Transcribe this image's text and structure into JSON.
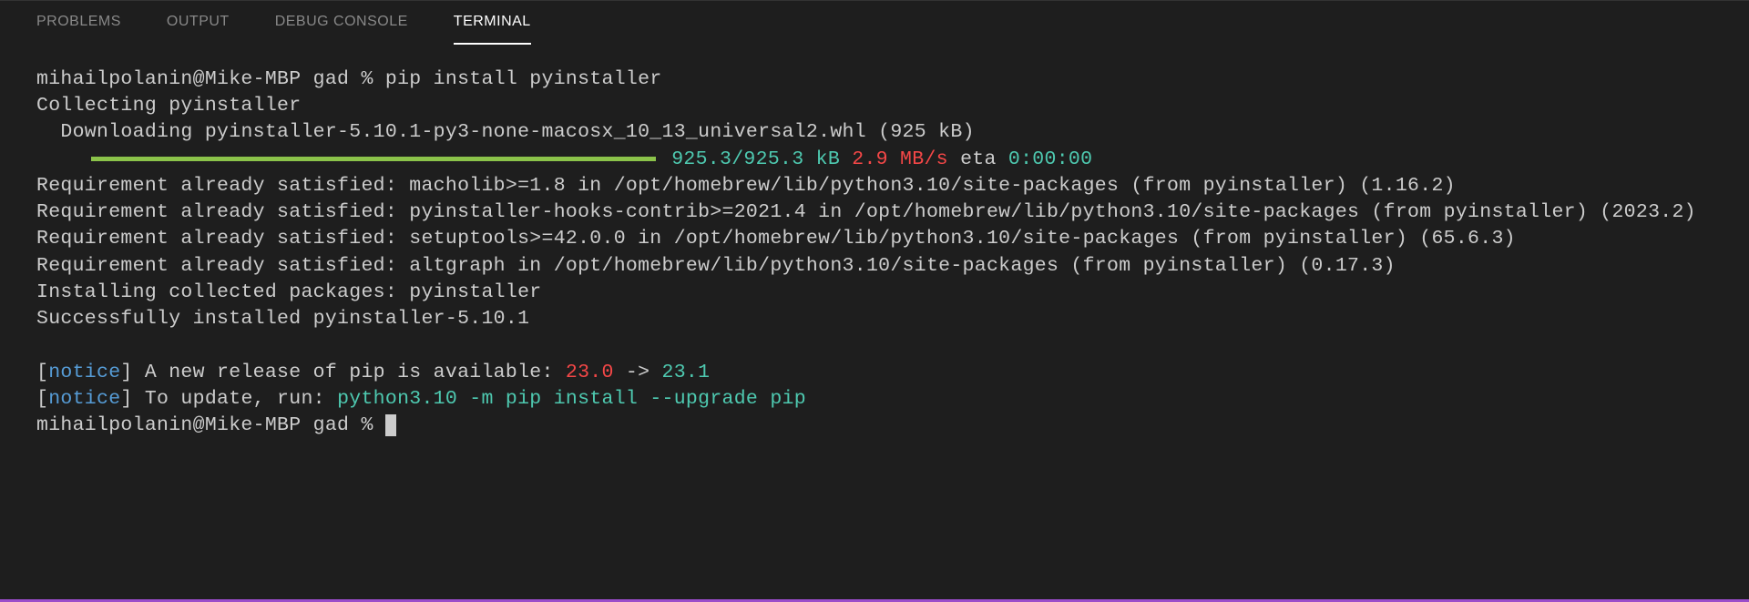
{
  "tabs": {
    "problems": "PROBLEMS",
    "output": "OUTPUT",
    "debug_console": "DEBUG CONSOLE",
    "terminal": "TERMINAL"
  },
  "terminal": {
    "prompt1": "mihailpolanin@Mike-MBP gad % ",
    "command1": "pip install pyinstaller",
    "line_collecting": "Collecting pyinstaller",
    "line_downloading": "  Downloading pyinstaller-5.10.1-py3-none-macosx_10_13_universal2.whl (925 kB)",
    "progress_size": " 925.3/925.3 kB",
    "progress_speed": " 2.9 MB/s",
    "progress_eta_label": " eta ",
    "progress_eta": "0:00:00",
    "req1": "Requirement already satisfied: macholib>=1.8 in /opt/homebrew/lib/python3.10/site-packages (from pyinstaller) (1.16.2)",
    "req2": "Requirement already satisfied: pyinstaller-hooks-contrib>=2021.4 in /opt/homebrew/lib/python3.10/site-packages (from pyinstaller) (2023.2)",
    "req3": "Requirement already satisfied: setuptools>=42.0.0 in /opt/homebrew/lib/python3.10/site-packages (from pyinstaller) (65.6.3)",
    "req4": "Requirement already satisfied: altgraph in /opt/homebrew/lib/python3.10/site-packages (from pyinstaller) (0.17.3)",
    "installing": "Installing collected packages: pyinstaller",
    "success": "Successfully installed pyinstaller-5.10.1",
    "blank": "",
    "notice1_pre": "[",
    "notice1_word": "notice",
    "notice1_post": "] A new release of pip is available: ",
    "notice1_old": "23.0",
    "notice1_arrow": " -> ",
    "notice1_new": "23.1",
    "notice2_pre": "[",
    "notice2_word": "notice",
    "notice2_post": "] To update, run: ",
    "notice2_cmd": "python3.10 -m pip install --upgrade pip",
    "prompt2": "mihailpolanin@Mike-MBP gad % "
  }
}
